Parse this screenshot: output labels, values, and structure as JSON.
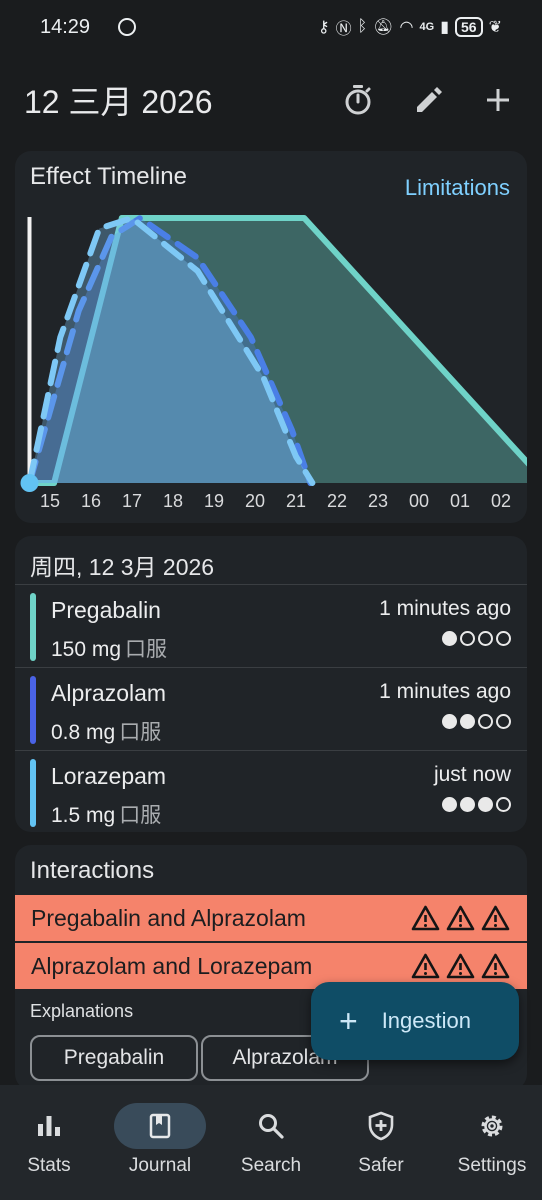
{
  "status_bar": {
    "time": "14:29",
    "network": "4G",
    "battery": "56"
  },
  "header": {
    "title": "12 三月 2026"
  },
  "timeline": {
    "title": "Effect Timeline",
    "limitations_label": "Limitations",
    "x_ticks": [
      "15",
      "16",
      "17",
      "18",
      "19",
      "20",
      "21",
      "22",
      "23",
      "00",
      "01",
      "02"
    ]
  },
  "chart_data": {
    "type": "area",
    "title": "Effect Timeline",
    "x_unit": "hour",
    "x_ticks": [
      "15",
      "16",
      "17",
      "18",
      "19",
      "20",
      "21",
      "22",
      "23",
      "00",
      "01",
      "02"
    ],
    "now_marker_hour": 14.5,
    "series": [
      {
        "name": "Pregabalin",
        "color": "#6fd3c8",
        "style": "solid",
        "points": [
          [
            14.5,
            0
          ],
          [
            15.1,
            0
          ],
          [
            16.75,
            1.0
          ],
          [
            21.2,
            1.0
          ],
          [
            24.15,
            0.5
          ],
          [
            27.1,
            0
          ]
        ]
      },
      {
        "name": "Alprazolam",
        "color": "#4a7fe6",
        "style": "dashed",
        "points": [
          [
            14.5,
            0
          ],
          [
            15.7,
            0.65
          ],
          [
            16.5,
            0.93
          ],
          [
            17.2,
            1.0
          ],
          [
            18.6,
            0.85
          ],
          [
            19.9,
            0.55
          ],
          [
            20.9,
            0.2
          ],
          [
            21.35,
            0
          ]
        ]
      },
      {
        "name": "Lorazepam",
        "color": "#7ec8f5",
        "style": "dashed",
        "points": [
          [
            14.5,
            0
          ],
          [
            15.25,
            0.55
          ],
          [
            16.2,
            0.96
          ],
          [
            17.0,
            1.0
          ],
          [
            18.6,
            0.8
          ],
          [
            20.2,
            0.4
          ],
          [
            21.0,
            0.1
          ],
          [
            21.4,
            0
          ]
        ]
      }
    ]
  },
  "day": {
    "title": "周四, 12 3月 2026",
    "ingestions": [
      {
        "name": "Pregabalin",
        "dose": "150 mg",
        "route": "口服",
        "time_ago": "1 minutes ago",
        "color": "#6fd3c8",
        "level": 1
      },
      {
        "name": "Alprazolam",
        "dose": "0.8 mg",
        "route": "口服",
        "time_ago": "1 minutes ago",
        "color": "#4a63e6",
        "level": 2
      },
      {
        "name": "Lorazepam",
        "dose": "1.5 mg",
        "route": "口服",
        "time_ago": "just now",
        "color": "#62c3f3",
        "level": 3
      }
    ]
  },
  "interactions": {
    "title": "Interactions",
    "items": [
      {
        "label": "Pregabalin and Alprazolam",
        "severity": 3,
        "color": "#f5836b"
      },
      {
        "label": "Alprazolam and Lorazepam",
        "severity": 3,
        "color": "#f5836b"
      }
    ],
    "explanations_label": "Explanations",
    "chips": [
      "Pregabalin",
      "Alprazolam"
    ]
  },
  "fab": {
    "label": "Ingestion",
    "icon": "plus-icon"
  },
  "nav": {
    "items": [
      {
        "label": "Stats",
        "icon": "bar-chart-icon",
        "active": false
      },
      {
        "label": "Journal",
        "icon": "journal-icon",
        "active": true
      },
      {
        "label": "Search",
        "icon": "search-icon",
        "active": false
      },
      {
        "label": "Safer",
        "icon": "shield-plus-icon",
        "active": false
      },
      {
        "label": "Settings",
        "icon": "gear-icon",
        "active": false
      }
    ]
  }
}
